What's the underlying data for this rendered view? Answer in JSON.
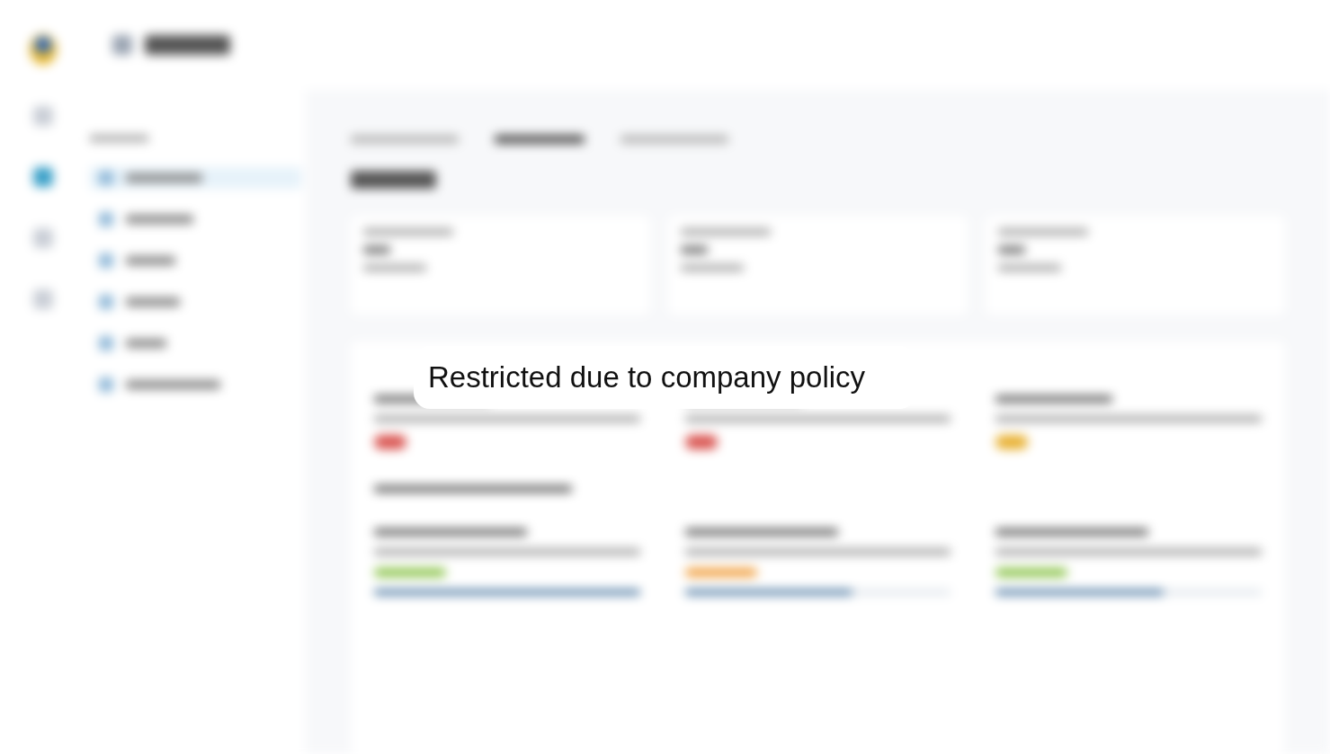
{
  "notice": {
    "text": "Restricted due to company policy"
  }
}
